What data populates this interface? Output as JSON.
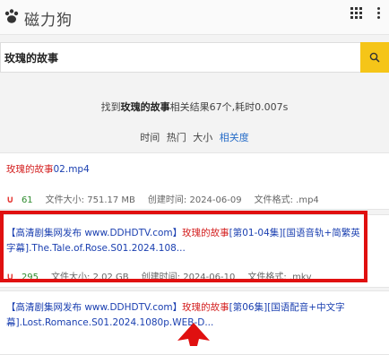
{
  "app": {
    "title": "磁力狗"
  },
  "search": {
    "value": "玫瑰的故事"
  },
  "summary": {
    "prefix": "找到",
    "keyword": "玫瑰的故事",
    "suffix": "相关结果67个,耗时0.007s"
  },
  "sort": {
    "options": [
      "时间",
      "热门",
      "大小",
      "相关度"
    ],
    "active": "相关度"
  },
  "results": [
    {
      "title_keyword": "玫瑰的故事",
      "title_rest": "02.mp4",
      "seeds": "61",
      "size_label": "文件大小:",
      "size": "751.17 MB",
      "created_label": "创建时间:",
      "created": "2024-06-09",
      "format_label": "文件格式:",
      "format": ".mp4"
    },
    {
      "title_pre": "【高清剧集网发布 www.DDHDTV.com】",
      "title_keyword": "玫瑰的故事",
      "title_rest": "[第01-04集][国语音轨+简繁英字幕].The.Tale.of.Rose.S01.2024.108...",
      "seeds": "295",
      "size_label": "文件大小:",
      "size": "2.02 GB",
      "created_label": "创建时间:",
      "created": "2024-06-10",
      "format_label": "文件格式:",
      "format": ".mkv"
    },
    {
      "title_pre": "【高清剧集网发布 www.DDHDTV.com】",
      "title_keyword": "玫瑰的故事",
      "title_rest": "[第06集][国语配音+中文字幕].Lost.Romance.S01.2024.1080p.WEB-D..."
    }
  ],
  "colors": {
    "accent": "#f5c518",
    "keyword": "#d42222",
    "link": "#1a3fb0",
    "annotation": "#e01010"
  }
}
